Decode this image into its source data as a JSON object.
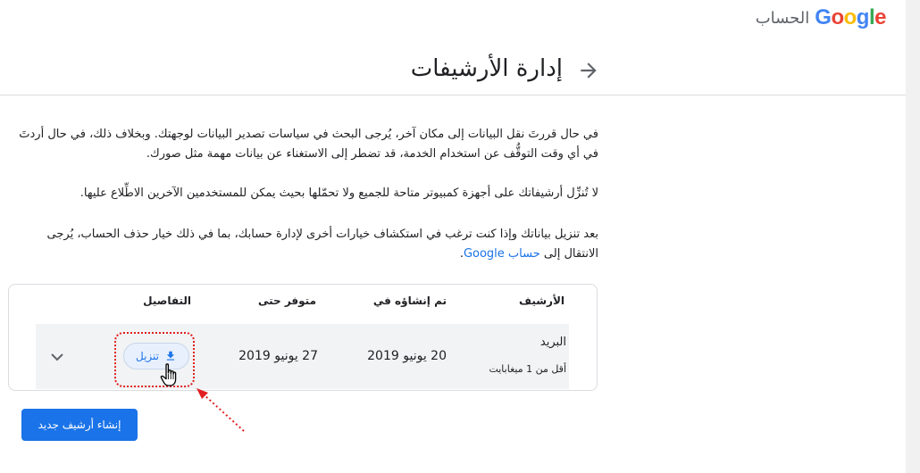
{
  "header": {
    "account_label": "الحساب",
    "logo_letters": [
      "G",
      "o",
      "o",
      "g",
      "l",
      "e"
    ]
  },
  "page": {
    "title": "إدارة الأرشيفات"
  },
  "intro": {
    "p1": "في حال قررتَ نقل البيانات إلى مكان آخر، يُرجى البحث في سياسات تصدير البيانات لوجهتك. وبخلاف ذلك، في حال أردتَ في أي وقت التوقُّف عن استخدام الخدمة، قد تضطر إلى الاستغناء عن بيانات مهمة مثل صورك.",
    "p2": "لا تُنزِّل أرشيفاتك على أجهزة كمبيوتر متاحة للجميع ولا تحمّلها بحيث يمكن للمستخدمين الآخرين الاطِّلاع عليها.",
    "p3_text": "بعد تنزيل بياناتك وإذا كنت ترغب في استكشاف خيارات أخرى لإدارة حسابك، بما في ذلك خيار حذف الحساب، يُرجى الانتقال إلى",
    "p3_link": "حساب Google",
    "p3_end": "."
  },
  "table": {
    "headers": {
      "archive": "الأرشيف",
      "created": "تم إنشاؤه في",
      "available": "متوفر حتى",
      "details": "التفاصيل"
    },
    "rows": [
      {
        "name": "البريد",
        "size": "أقل من 1 ميغابايت",
        "created": "20 يونيو 2019",
        "available": "27 يونيو 2019",
        "download_label": "تنزيل"
      }
    ]
  },
  "actions": {
    "create_label": "إنشاء أرشيف جديد"
  },
  "colors": {
    "primary": "#1a73e8",
    "annotation": "#e02020",
    "row_bg": "#f1f3f4",
    "border": "#dadce0"
  },
  "icons": {
    "back": "arrow-forward-icon",
    "download": "download-icon",
    "expand": "chevron-down-icon",
    "cursor": "hand-pointer-icon"
  }
}
